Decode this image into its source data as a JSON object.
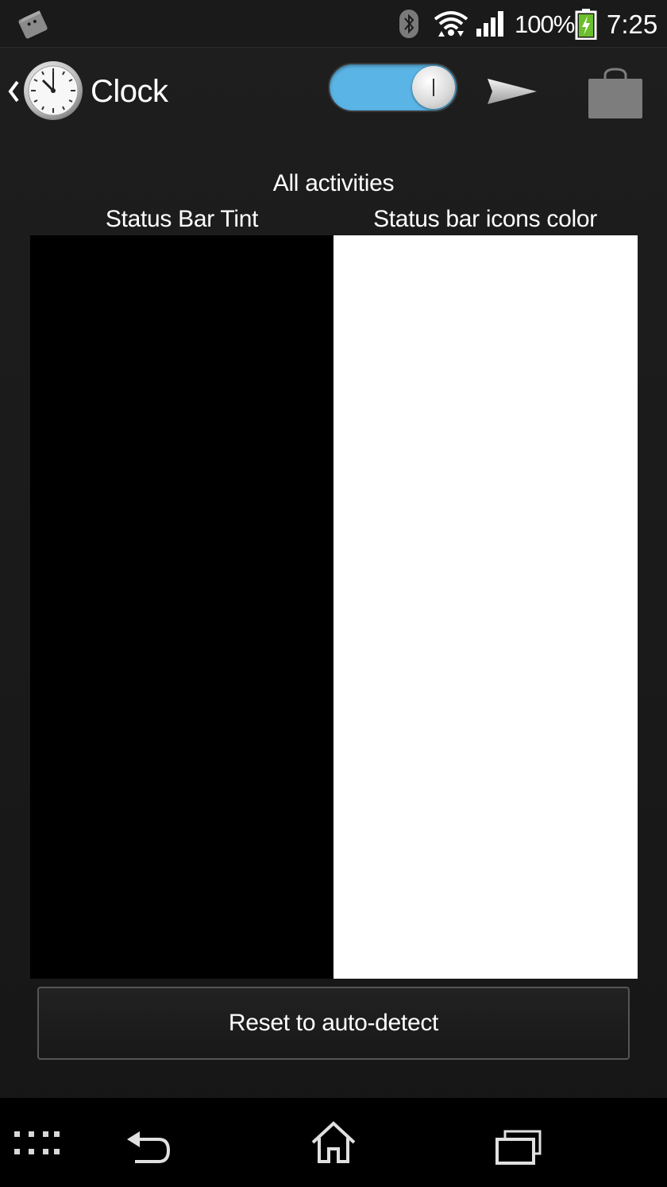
{
  "status_bar": {
    "battery_percent": "100%",
    "time": "7:25",
    "icons": [
      "notification-icon",
      "bluetooth-icon",
      "wifi-icon",
      "signal-icon",
      "battery-charging-icon"
    ]
  },
  "action_bar": {
    "title": "Clock",
    "toggle_on": true,
    "icons": [
      "up-chevron-icon",
      "clock-app-icon",
      "send-icon",
      "shopping-bag-icon"
    ]
  },
  "content": {
    "section_title": "All activities",
    "left_label": "Status Bar Tint",
    "right_label": "Status bar icons color",
    "left_color": "#000000",
    "right_color": "#ffffff",
    "reset_label": "Reset to auto-detect"
  },
  "nav_bar": {
    "icons": [
      "apps-grid-icon",
      "back-icon",
      "home-icon",
      "recent-apps-icon"
    ]
  },
  "colors": {
    "accent": "#5bb4e6",
    "background": "#1b1b1b"
  }
}
